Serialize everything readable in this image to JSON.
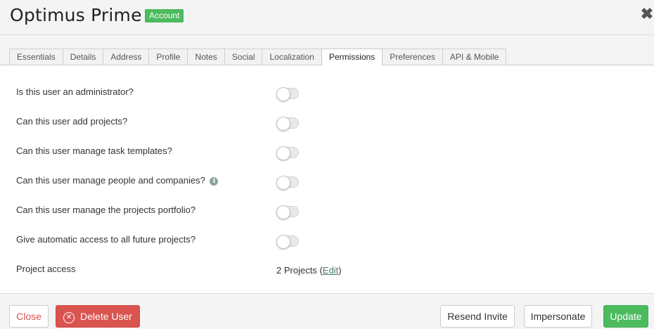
{
  "header": {
    "title": "Optimus Prime",
    "badge": "Account",
    "close_glyph": "✖"
  },
  "tabs": [
    {
      "label": "Essentials",
      "active": false
    },
    {
      "label": "Details",
      "active": false
    },
    {
      "label": "Address",
      "active": false
    },
    {
      "label": "Profile",
      "active": false
    },
    {
      "label": "Notes",
      "active": false
    },
    {
      "label": "Social",
      "active": false
    },
    {
      "label": "Localization",
      "active": false
    },
    {
      "label": "Permissions",
      "active": true
    },
    {
      "label": "Preferences",
      "active": false
    },
    {
      "label": "API & Mobile",
      "active": false
    }
  ],
  "permissions": [
    {
      "label": "Is this user an administrator?",
      "enabled": false
    },
    {
      "label": "Can this user add projects?",
      "enabled": false
    },
    {
      "label": "Can this user manage task templates?",
      "enabled": false
    },
    {
      "label": "Can this user manage people and companies?",
      "enabled": false,
      "info_icon": "i"
    },
    {
      "label": "Can this user manage the projects portfolio?",
      "enabled": false
    },
    {
      "label": "Give automatic access to all future projects?",
      "enabled": false
    }
  ],
  "project_access": {
    "label": "Project access",
    "value": "2 Projects",
    "paren_open": "(",
    "edit_label": "Edit",
    "paren_close": ")"
  },
  "footer": {
    "close_label": "Close",
    "delete_label": "Delete User",
    "delete_icon": "✕",
    "resend_label": "Resend Invite",
    "impersonate_label": "Impersonate",
    "update_label": "Update"
  },
  "colors": {
    "accent_green": "#4cbb5e",
    "danger_red": "#d9534f",
    "link_green": "#4a7a68"
  }
}
